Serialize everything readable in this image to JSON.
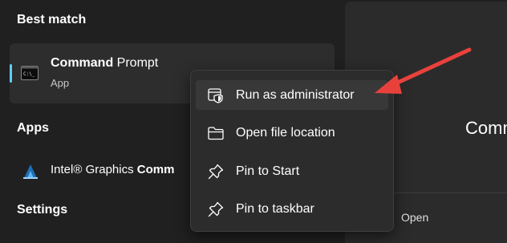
{
  "sections": {
    "best_match": "Best match",
    "apps": "Apps",
    "settings": "Settings"
  },
  "best_match_item": {
    "title_bold": "Command",
    "title_rest": " Prompt",
    "subtitle": "App",
    "icon": "command-prompt-icon"
  },
  "apps_item": {
    "label_prefix": "Intel® Graphics ",
    "label_bold": "Comm",
    "icon": "intel-graphics-icon"
  },
  "context_menu": {
    "items": [
      {
        "label": "Run as administrator",
        "icon": "shield-admin-icon"
      },
      {
        "label": "Open file location",
        "icon": "folder-icon"
      },
      {
        "label": "Pin to Start",
        "icon": "pin-icon"
      },
      {
        "label": "Pin to taskbar",
        "icon": "pin-icon"
      }
    ]
  },
  "right_panel": {
    "title": "Comm",
    "open_label": "Open"
  },
  "colors": {
    "background": "#202020",
    "card": "#2d2d2d",
    "menu": "#2c2c2c",
    "accent": "#60cdff",
    "annotation_arrow": "#e8413c"
  }
}
